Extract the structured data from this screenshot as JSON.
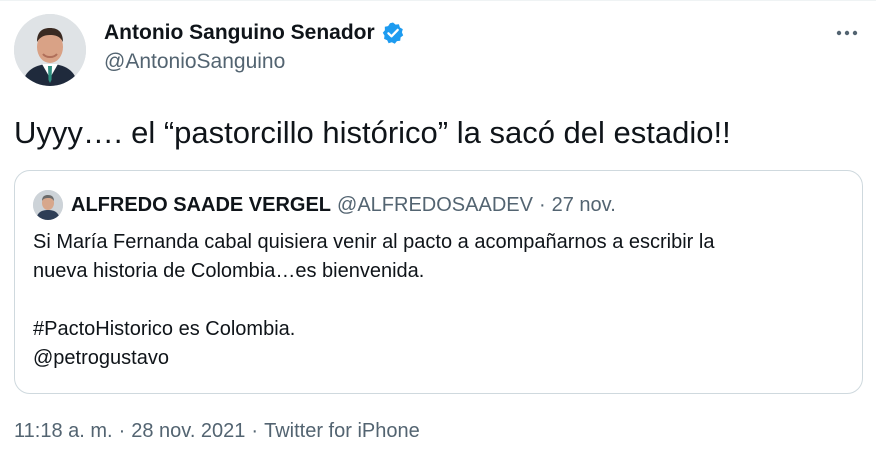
{
  "author": {
    "display_name": "Antonio Sanguino Senador",
    "handle": "@AntonioSanguino",
    "verified": true
  },
  "tweet": {
    "text": "Uyyy…. el “pastorcillo histórico” la sacó del estadio!!"
  },
  "quoted": {
    "display_name": "ALFREDO SAADE VERGEL",
    "handle": "@ALFREDOSAADEV",
    "separator": "·",
    "date": "27 nov.",
    "lines": [
      "Si María Fernanda cabal quisiera venir al pacto a acompañarnos a escribir la",
      "nueva historia de Colombia…es bienvenida.",
      "",
      "#PactoHistorico es Colombia.",
      "@petrogustavo"
    ]
  },
  "meta": {
    "time": "11:18 a. m.",
    "separator": "·",
    "date": "28 nov. 2021",
    "source": "Twitter for iPhone"
  },
  "icons": {
    "verified": "verified-badge-icon",
    "more": "more-options-icon"
  },
  "colors": {
    "verified_blue": "#1d9bf0",
    "secondary_text": "#536471",
    "border": "#cfd9de"
  }
}
